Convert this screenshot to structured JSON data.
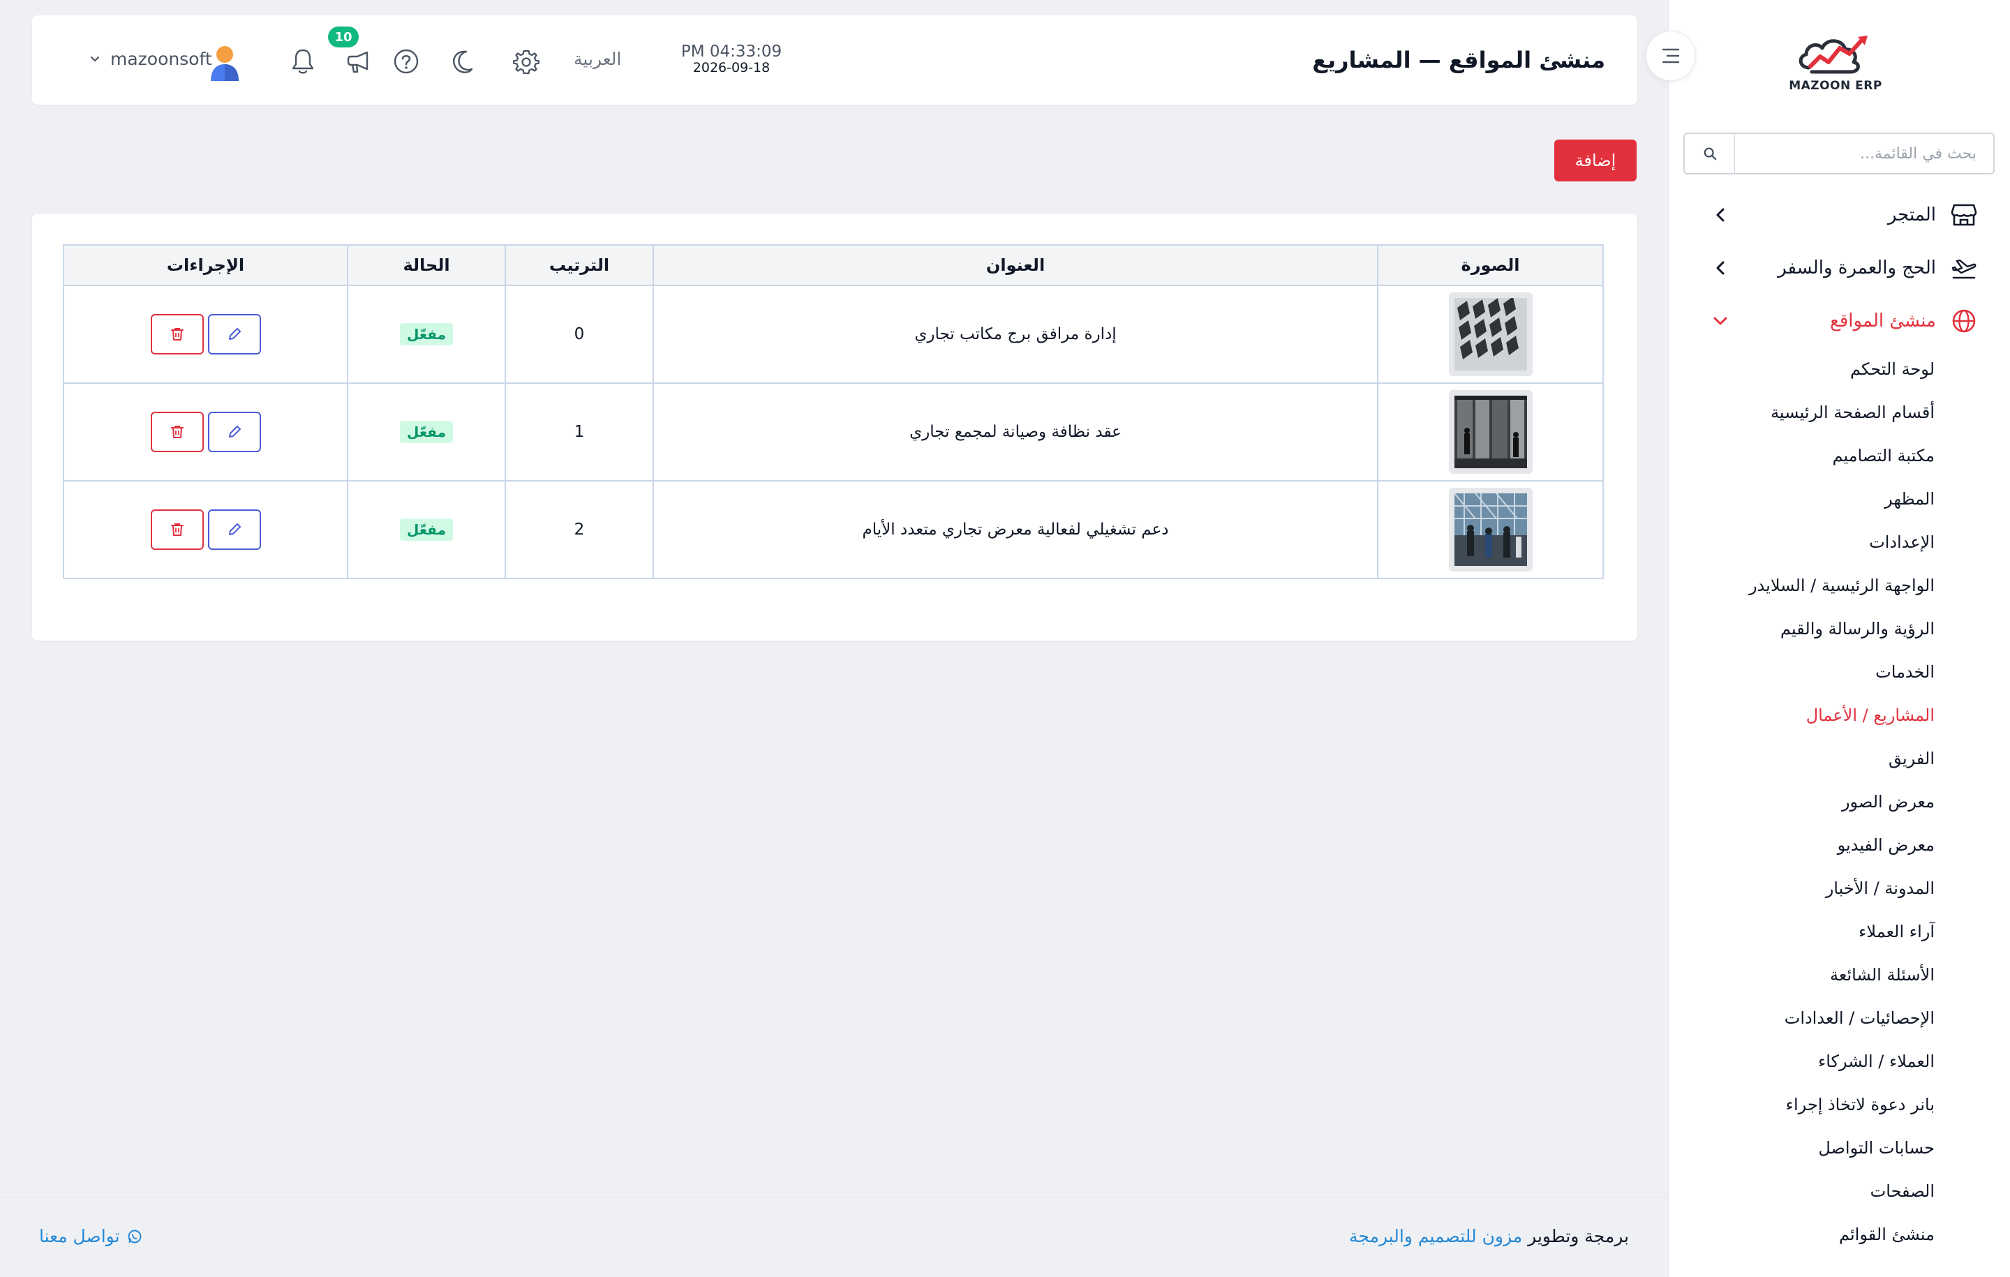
{
  "app": {
    "logo_text": "MAZOON ERP",
    "accent_color": "#e2313d",
    "success_color": "#10b981",
    "link_color": "#2589d6"
  },
  "header": {
    "title": "منشئ المواقع — المشاريع",
    "time": "PM 04:33:09",
    "date": "2026-09-18",
    "language": "العربية",
    "notification_count": "10",
    "username": "mazoonsoft",
    "icons": [
      "settings-icon",
      "moon-icon",
      "help-icon",
      "megaphone-icon",
      "bell-icon",
      "user-avatar",
      "chevron-down-icon"
    ]
  },
  "sidebar": {
    "search_placeholder": "بحث في القائمة...",
    "groups": [
      {
        "label": "المتجر",
        "icon": "store-icon",
        "expanded": false
      },
      {
        "label": "الحج والعمرة والسفر",
        "icon": "plane-icon",
        "expanded": false
      },
      {
        "label": "منشئ المواقع",
        "icon": "globe-icon",
        "expanded": true,
        "active": true
      }
    ],
    "items": [
      {
        "label": "لوحة التحكم"
      },
      {
        "label": "أقسام الصفحة الرئيسية"
      },
      {
        "label": "مكتبة التصاميم"
      },
      {
        "label": "المظهر"
      },
      {
        "label": "الإعدادات"
      },
      {
        "label": "الواجهة الرئيسية / السلايدر"
      },
      {
        "label": "الرؤية والرسالة والقيم"
      },
      {
        "label": "الخدمات"
      },
      {
        "label": "المشاريع / الأعمال",
        "active": true
      },
      {
        "label": "الفريق"
      },
      {
        "label": "معرض الصور"
      },
      {
        "label": "معرض الفيديو"
      },
      {
        "label": "المدونة / الأخبار"
      },
      {
        "label": "آراء العملاء"
      },
      {
        "label": "الأسئلة الشائعة"
      },
      {
        "label": "الإحصائيات / العدادات"
      },
      {
        "label": "العملاء / الشركاء"
      },
      {
        "label": "بانر دعوة لاتخاذ إجراء"
      },
      {
        "label": "حسابات التواصل"
      },
      {
        "label": "الصفحات"
      },
      {
        "label": "منشئ القوائم"
      }
    ]
  },
  "main": {
    "add_button": "إضافة",
    "table": {
      "columns": [
        "الصورة",
        "العنوان",
        "الترتيب",
        "الحالة",
        "الإجراءات"
      ],
      "rows": [
        {
          "image": "building-facade-photo",
          "title": "إدارة مرافق برج مكاتب تجاري",
          "order": "0",
          "status": "مفعّل"
        },
        {
          "image": "glass-entrance-photo",
          "title": "عقد نظافة وصيانة لمجمع تجاري",
          "order": "1",
          "status": "مفعّل"
        },
        {
          "image": "exhibition-crowd-photo",
          "title": "دعم تشغيلي لفعالية معرض تجاري متعدد الأيام",
          "order": "2",
          "status": "مفعّل"
        }
      ]
    }
  },
  "footer": {
    "credit_prefix": "برمجة وتطوير",
    "credit_brand": "مزون للتصميم والبرمجة",
    "contact": "تواصل معنا"
  }
}
